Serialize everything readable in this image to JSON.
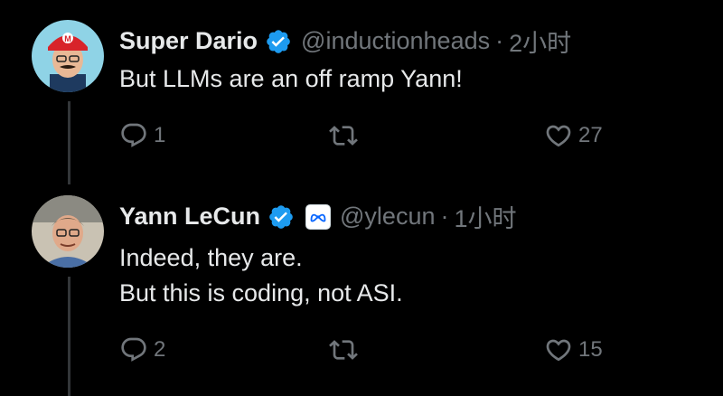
{
  "tweets": [
    {
      "display_name": "Super Dario",
      "handle": "@inductionheads",
      "separator": "·",
      "time": "2小时",
      "text": "But LLMs are an off ramp Yann!",
      "replies": "1",
      "retweets": "",
      "likes": "27",
      "avatar": "mario-hat-avatar"
    },
    {
      "display_name": "Yann LeCun",
      "handle": "@ylecun",
      "separator": "·",
      "time": "1小时",
      "text_line1": "Indeed, they are.",
      "text_line2": "But this is coding, not ASI.",
      "replies": "2",
      "retweets": "",
      "likes": "15",
      "affiliate": "meta-logo",
      "avatar": "yann-avatar"
    }
  ],
  "colors": {
    "background": "#000000",
    "text": "#e7e9ea",
    "muted": "#71767b",
    "verified": "#1d9bf0",
    "thread_line": "#333639"
  }
}
